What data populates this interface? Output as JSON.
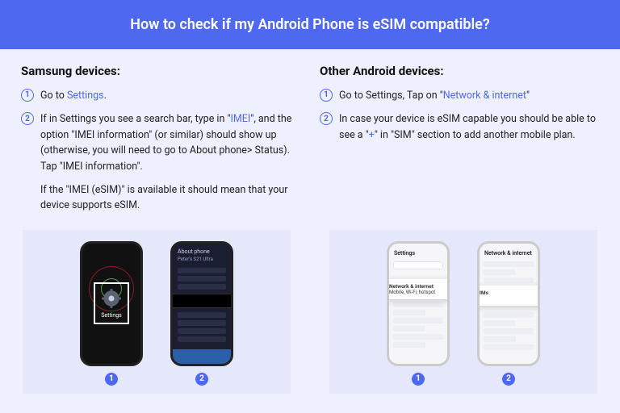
{
  "banner": "How to check if my Android Phone is eSIM compatible?",
  "samsung": {
    "heading": "Samsung devices:",
    "step1_a": "Go to ",
    "step1_link": "Settings",
    "step1_b": ".",
    "step2_a": "If in Settings you see a search bar, type in \"",
    "step2_link": "IMEI",
    "step2_b": "\", and the option \"IMEI information\" (or similar) should show up (otherwise, you will need to go to About phone> Status). Tap \"IMEI information\".",
    "note": "If the \"IMEI (eSIM)\" is available it should mean that your device supports eSIM."
  },
  "other": {
    "heading": "Other Android devices:",
    "step1_a": "Go to Settings, Tap on \"",
    "step1_link": "Network & internet",
    "step1_b": "\"",
    "step2_a": "In case your device is eSIM capable you should be able to see a \"",
    "step2_link": "+",
    "step2_b": "\" in \"SIM\" section to add another mobile plan."
  },
  "phones": {
    "settings_label": "Settings",
    "about_title": "About phone",
    "about_sub": "Peter's S21 Ultra",
    "light1_title": "Settings",
    "pop1_title": "Network & internet",
    "pop1_sub": "Mobile, Wi-Fi, hotspot",
    "light2_title": "Network & internet",
    "pop2_title": "SIMs",
    "badge1": "1",
    "badge2": "2"
  }
}
